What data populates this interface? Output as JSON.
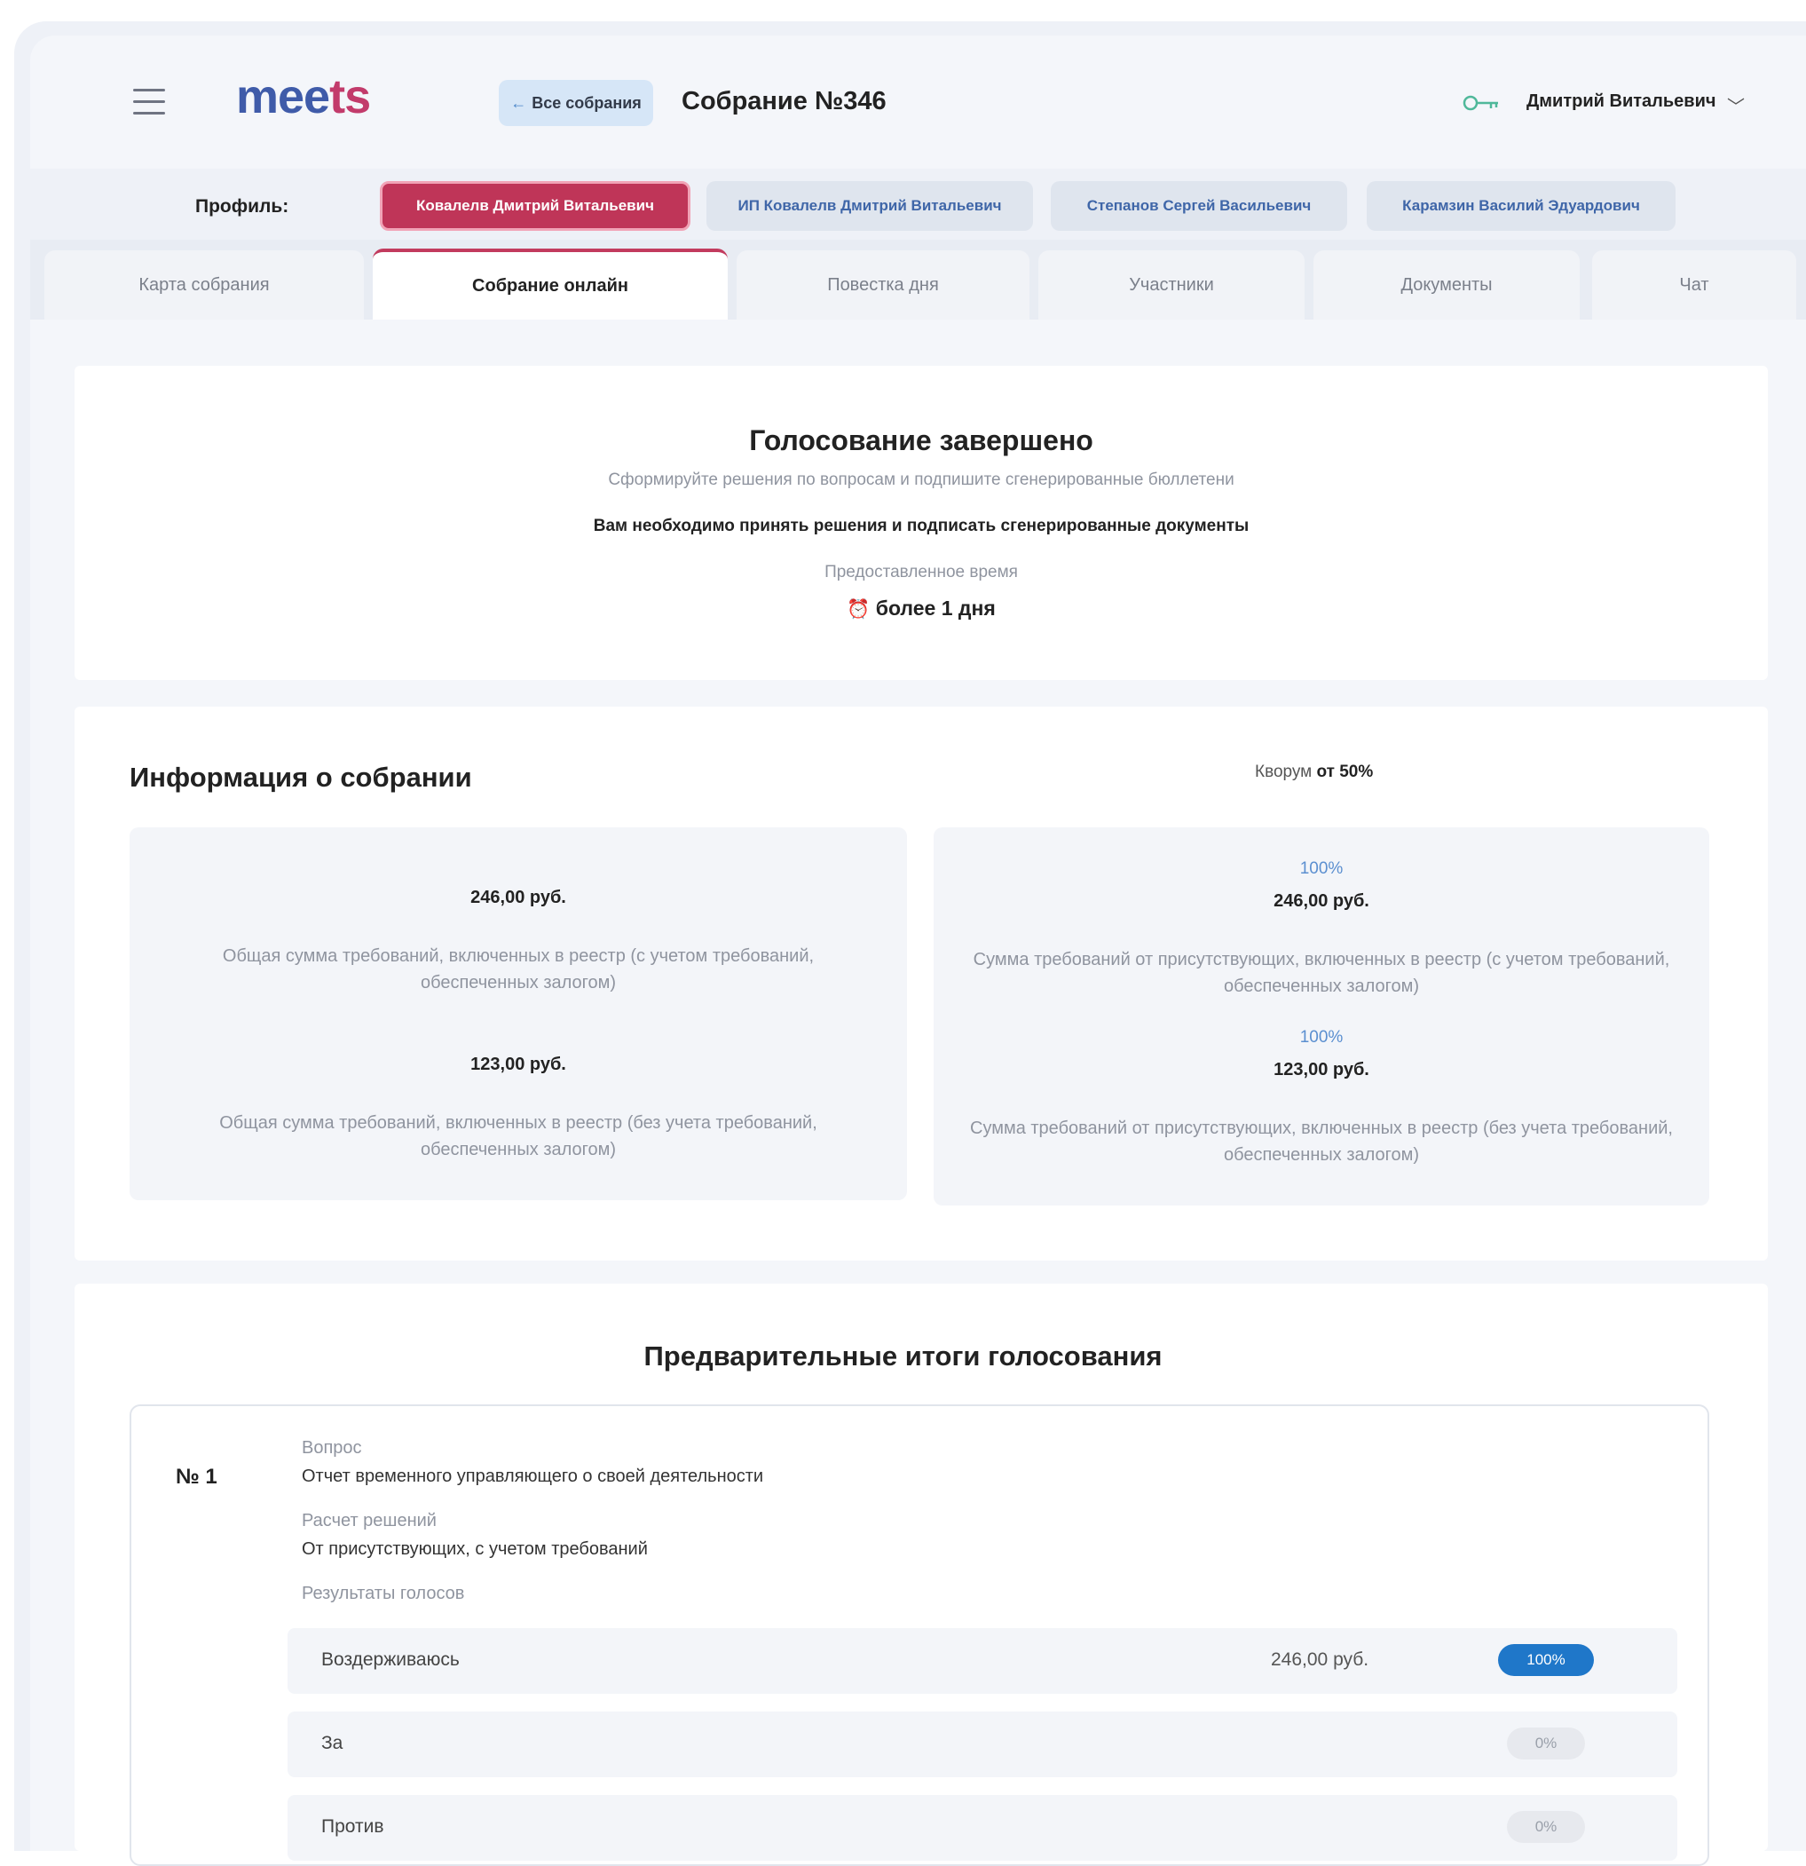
{
  "app": {
    "logo_part1": "mee",
    "logo_part2": "ts"
  },
  "header": {
    "back_label": "Все собрания",
    "back_arrow": "←",
    "meeting_title": "Собрание №346",
    "user_name": "Дмитрий Витальевич",
    "user_chevron": "﹀",
    "icons": [
      "menu-icon",
      "key-icon",
      "chevron-down-icon"
    ]
  },
  "profile": {
    "label": "Профиль:",
    "chips": [
      {
        "label": "Ковалелв Дмитрий Витальевич",
        "active": true
      },
      {
        "label": "ИП Ковалелв Дмитрий Витальевич",
        "active": false
      },
      {
        "label": "Степанов Сергей Васильевич",
        "active": false
      },
      {
        "label": "Карамзин Василий Эдуардович",
        "active": false
      }
    ]
  },
  "tabs": [
    {
      "label": "Карта собрания",
      "active": false
    },
    {
      "label": "Собрание онлайн",
      "active": true
    },
    {
      "label": "Повестка дня",
      "active": false
    },
    {
      "label": "Участники",
      "active": false
    },
    {
      "label": "Документы",
      "active": false
    },
    {
      "label": "Чат",
      "active": false
    }
  ],
  "status": {
    "title": "Голосование завершено",
    "subtitle": "Сформируйте решения по вопросам и подпишите сгенерированные бюллетени",
    "notice": "Вам необходимо принять решения и подписать сгенерированные документы",
    "time_label": "Предоставленное время",
    "time_value": "более 1 дня",
    "time_icon": "⏰"
  },
  "info": {
    "title": "Информация о собрании",
    "quorum_label": "Кворум",
    "quorum_value": "от 50%",
    "left": [
      {
        "amount": "246,00 руб.",
        "desc": "Общая сумма требований, включенных в реестр (с учетом требований, обеспеченных залогом)"
      },
      {
        "amount": "123,00 руб.",
        "desc": "Общая сумма требований, включенных в реестр (без учета требований, обеспеченных залогом)"
      }
    ],
    "right": [
      {
        "percent": "100%",
        "amount": "246,00 руб.",
        "desc": "Сумма требований от присутствующих, включенных в реестр (с учетом требований, обеспеченных залогом)"
      },
      {
        "percent": "100%",
        "amount": "123,00 руб.",
        "desc": "Сумма требований от присутствующих, включенных в реестр (без учета требований, обеспеченных залогом)"
      }
    ]
  },
  "results": {
    "title": "Предварительные итоги голосования",
    "question": {
      "number": "№ 1",
      "question_label": "Вопрос",
      "question_text": "Отчет временного управляющего о своей деятельности",
      "calc_label": "Расчет решений",
      "calc_text": "От присутствующих, с учетом требований",
      "votes_label": "Результаты голосов",
      "votes": [
        {
          "label": "Воздерживаюсь",
          "sum": "246,00 руб.",
          "percent": "100%",
          "share": 1.0
        },
        {
          "label": "За",
          "sum": "",
          "percent": "0%",
          "share": 0
        },
        {
          "label": "Против",
          "sum": "",
          "percent": "0%",
          "share": 0
        }
      ]
    }
  },
  "colors": {
    "brand_blue": "#3f5ba9",
    "brand_red": "#c23b6b",
    "active_chip": "#bf3558",
    "badge_blue": "#1f77c9"
  }
}
